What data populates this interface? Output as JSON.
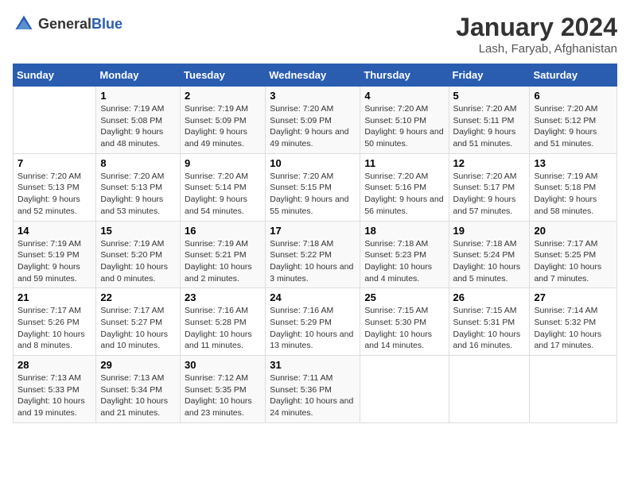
{
  "header": {
    "logo_general": "General",
    "logo_blue": "Blue",
    "title": "January 2024",
    "subtitle": "Lash, Faryab, Afghanistan"
  },
  "days_of_week": [
    "Sunday",
    "Monday",
    "Tuesday",
    "Wednesday",
    "Thursday",
    "Friday",
    "Saturday"
  ],
  "weeks": [
    [
      {
        "day": "",
        "sunrise": "",
        "sunset": "",
        "daylight": "",
        "empty": true
      },
      {
        "day": "1",
        "sunrise": "Sunrise: 7:19 AM",
        "sunset": "Sunset: 5:08 PM",
        "daylight": "Daylight: 9 hours and 48 minutes."
      },
      {
        "day": "2",
        "sunrise": "Sunrise: 7:19 AM",
        "sunset": "Sunset: 5:09 PM",
        "daylight": "Daylight: 9 hours and 49 minutes."
      },
      {
        "day": "3",
        "sunrise": "Sunrise: 7:20 AM",
        "sunset": "Sunset: 5:09 PM",
        "daylight": "Daylight: 9 hours and 49 minutes."
      },
      {
        "day": "4",
        "sunrise": "Sunrise: 7:20 AM",
        "sunset": "Sunset: 5:10 PM",
        "daylight": "Daylight: 9 hours and 50 minutes."
      },
      {
        "day": "5",
        "sunrise": "Sunrise: 7:20 AM",
        "sunset": "Sunset: 5:11 PM",
        "daylight": "Daylight: 9 hours and 51 minutes."
      },
      {
        "day": "6",
        "sunrise": "Sunrise: 7:20 AM",
        "sunset": "Sunset: 5:12 PM",
        "daylight": "Daylight: 9 hours and 51 minutes."
      }
    ],
    [
      {
        "day": "7",
        "sunrise": "Sunrise: 7:20 AM",
        "sunset": "Sunset: 5:13 PM",
        "daylight": "Daylight: 9 hours and 52 minutes."
      },
      {
        "day": "8",
        "sunrise": "Sunrise: 7:20 AM",
        "sunset": "Sunset: 5:13 PM",
        "daylight": "Daylight: 9 hours and 53 minutes."
      },
      {
        "day": "9",
        "sunrise": "Sunrise: 7:20 AM",
        "sunset": "Sunset: 5:14 PM",
        "daylight": "Daylight: 9 hours and 54 minutes."
      },
      {
        "day": "10",
        "sunrise": "Sunrise: 7:20 AM",
        "sunset": "Sunset: 5:15 PM",
        "daylight": "Daylight: 9 hours and 55 minutes."
      },
      {
        "day": "11",
        "sunrise": "Sunrise: 7:20 AM",
        "sunset": "Sunset: 5:16 PM",
        "daylight": "Daylight: 9 hours and 56 minutes."
      },
      {
        "day": "12",
        "sunrise": "Sunrise: 7:20 AM",
        "sunset": "Sunset: 5:17 PM",
        "daylight": "Daylight: 9 hours and 57 minutes."
      },
      {
        "day": "13",
        "sunrise": "Sunrise: 7:19 AM",
        "sunset": "Sunset: 5:18 PM",
        "daylight": "Daylight: 9 hours and 58 minutes."
      }
    ],
    [
      {
        "day": "14",
        "sunrise": "Sunrise: 7:19 AM",
        "sunset": "Sunset: 5:19 PM",
        "daylight": "Daylight: 9 hours and 59 minutes."
      },
      {
        "day": "15",
        "sunrise": "Sunrise: 7:19 AM",
        "sunset": "Sunset: 5:20 PM",
        "daylight": "Daylight: 10 hours and 0 minutes."
      },
      {
        "day": "16",
        "sunrise": "Sunrise: 7:19 AM",
        "sunset": "Sunset: 5:21 PM",
        "daylight": "Daylight: 10 hours and 2 minutes."
      },
      {
        "day": "17",
        "sunrise": "Sunrise: 7:18 AM",
        "sunset": "Sunset: 5:22 PM",
        "daylight": "Daylight: 10 hours and 3 minutes."
      },
      {
        "day": "18",
        "sunrise": "Sunrise: 7:18 AM",
        "sunset": "Sunset: 5:23 PM",
        "daylight": "Daylight: 10 hours and 4 minutes."
      },
      {
        "day": "19",
        "sunrise": "Sunrise: 7:18 AM",
        "sunset": "Sunset: 5:24 PM",
        "daylight": "Daylight: 10 hours and 5 minutes."
      },
      {
        "day": "20",
        "sunrise": "Sunrise: 7:17 AM",
        "sunset": "Sunset: 5:25 PM",
        "daylight": "Daylight: 10 hours and 7 minutes."
      }
    ],
    [
      {
        "day": "21",
        "sunrise": "Sunrise: 7:17 AM",
        "sunset": "Sunset: 5:26 PM",
        "daylight": "Daylight: 10 hours and 8 minutes."
      },
      {
        "day": "22",
        "sunrise": "Sunrise: 7:17 AM",
        "sunset": "Sunset: 5:27 PM",
        "daylight": "Daylight: 10 hours and 10 minutes."
      },
      {
        "day": "23",
        "sunrise": "Sunrise: 7:16 AM",
        "sunset": "Sunset: 5:28 PM",
        "daylight": "Daylight: 10 hours and 11 minutes."
      },
      {
        "day": "24",
        "sunrise": "Sunrise: 7:16 AM",
        "sunset": "Sunset: 5:29 PM",
        "daylight": "Daylight: 10 hours and 13 minutes."
      },
      {
        "day": "25",
        "sunrise": "Sunrise: 7:15 AM",
        "sunset": "Sunset: 5:30 PM",
        "daylight": "Daylight: 10 hours and 14 minutes."
      },
      {
        "day": "26",
        "sunrise": "Sunrise: 7:15 AM",
        "sunset": "Sunset: 5:31 PM",
        "daylight": "Daylight: 10 hours and 16 minutes."
      },
      {
        "day": "27",
        "sunrise": "Sunrise: 7:14 AM",
        "sunset": "Sunset: 5:32 PM",
        "daylight": "Daylight: 10 hours and 17 minutes."
      }
    ],
    [
      {
        "day": "28",
        "sunrise": "Sunrise: 7:13 AM",
        "sunset": "Sunset: 5:33 PM",
        "daylight": "Daylight: 10 hours and 19 minutes."
      },
      {
        "day": "29",
        "sunrise": "Sunrise: 7:13 AM",
        "sunset": "Sunset: 5:34 PM",
        "daylight": "Daylight: 10 hours and 21 minutes."
      },
      {
        "day": "30",
        "sunrise": "Sunrise: 7:12 AM",
        "sunset": "Sunset: 5:35 PM",
        "daylight": "Daylight: 10 hours and 23 minutes."
      },
      {
        "day": "31",
        "sunrise": "Sunrise: 7:11 AM",
        "sunset": "Sunset: 5:36 PM",
        "daylight": "Daylight: 10 hours and 24 minutes."
      },
      {
        "day": "",
        "sunrise": "",
        "sunset": "",
        "daylight": "",
        "empty": true
      },
      {
        "day": "",
        "sunrise": "",
        "sunset": "",
        "daylight": "",
        "empty": true
      },
      {
        "day": "",
        "sunrise": "",
        "sunset": "",
        "daylight": "",
        "empty": true
      }
    ]
  ]
}
